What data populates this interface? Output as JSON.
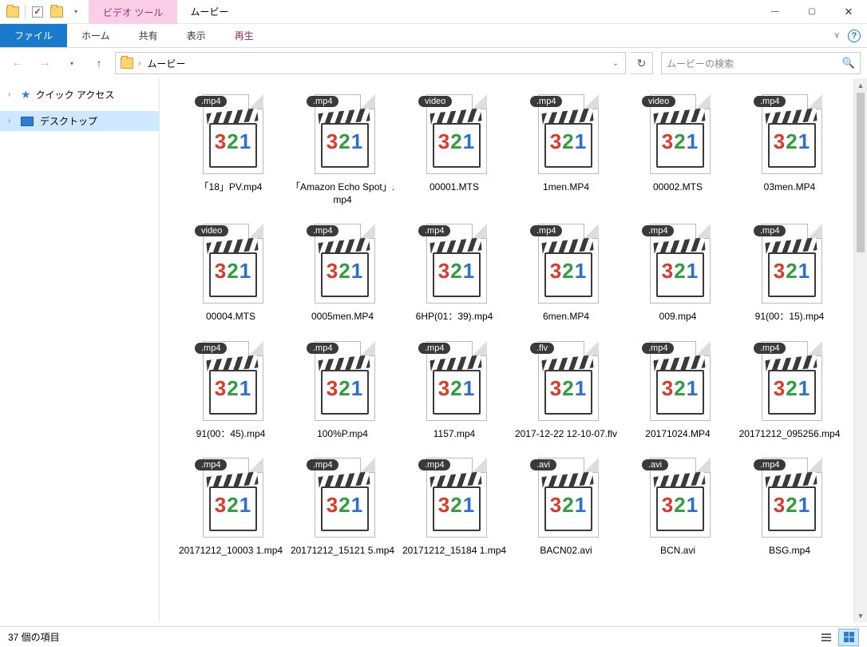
{
  "window": {
    "context_tab": "ビデオ ツール",
    "title": "ムービー",
    "tabs": {
      "file": "ファイル",
      "home": "ホーム",
      "share": "共有",
      "view": "表示",
      "play": "再生"
    }
  },
  "address": {
    "crumb": "ムービー",
    "sep": "›"
  },
  "search": {
    "placeholder": "ムービーの検索"
  },
  "nav": {
    "quick_access": "クイック アクセス",
    "desktop": "デスクトップ"
  },
  "files": [
    {
      "badge": ".mp4",
      "name": "「18」PV.mp4"
    },
    {
      "badge": ".mp4",
      "name": "「Amazon Echo Spot」.mp4"
    },
    {
      "badge": "video",
      "name": "00001.MTS"
    },
    {
      "badge": ".mp4",
      "name": "1men.MP4"
    },
    {
      "badge": "video",
      "name": "00002.MTS"
    },
    {
      "badge": ".mp4",
      "name": "03men.MP4"
    },
    {
      "badge": "video",
      "name": "00004.MTS"
    },
    {
      "badge": ".mp4",
      "name": "0005men.MP4"
    },
    {
      "badge": ".mp4",
      "name": "6HP(01：39).mp4"
    },
    {
      "badge": ".mp4",
      "name": "6men.MP4"
    },
    {
      "badge": ".mp4",
      "name": "009.mp4"
    },
    {
      "badge": ".mp4",
      "name": "91(00：15).mp4"
    },
    {
      "badge": ".mp4",
      "name": "91(00：45).mp4"
    },
    {
      "badge": ".mp4",
      "name": "100%P.mp4"
    },
    {
      "badge": ".mp4",
      "name": "1157.mp4"
    },
    {
      "badge": ".flv",
      "name": "2017-12-22 12-10-07.flv"
    },
    {
      "badge": ".mp4",
      "name": "20171024.MP4"
    },
    {
      "badge": ".mp4",
      "name": "20171212_095256.mp4"
    },
    {
      "badge": ".mp4",
      "name": "20171212_10003 1.mp4"
    },
    {
      "badge": ".mp4",
      "name": "20171212_15121 5.mp4"
    },
    {
      "badge": ".mp4",
      "name": "20171212_15184 1.mp4"
    },
    {
      "badge": ".avi",
      "name": "BACN02.avi"
    },
    {
      "badge": ".avi",
      "name": "BCN.avi"
    },
    {
      "badge": ".mp4",
      "name": "BSG.mp4"
    }
  ],
  "status": {
    "text": "37 個の項目"
  }
}
